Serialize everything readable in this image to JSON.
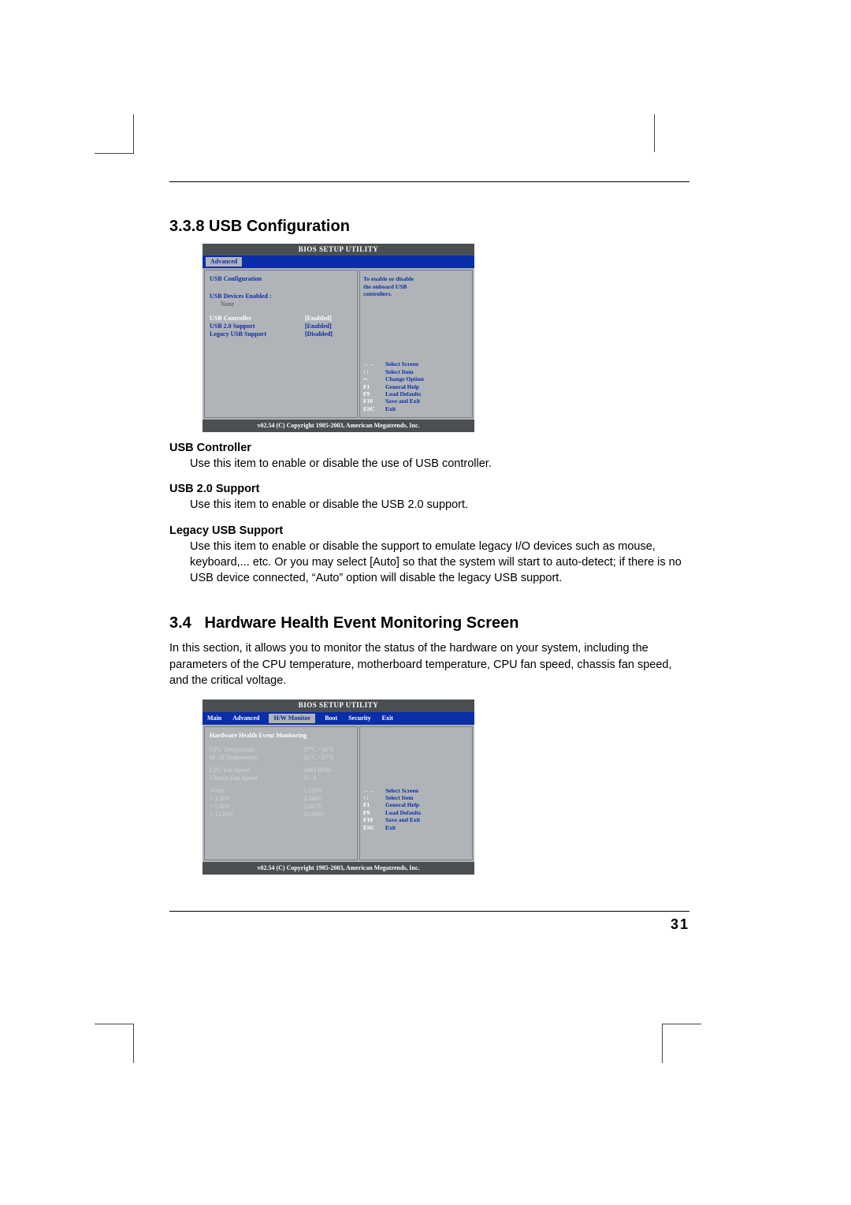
{
  "section1": {
    "number": "3.3.8",
    "title": "USB Configuration"
  },
  "bios1": {
    "title": "BIOS SETUP UTILITY",
    "active_tab": "Advanced",
    "panel_title": "USB Configuration",
    "devices_label": "USB Devices Enabled :",
    "devices_value": "None",
    "rows": [
      {
        "label": "USB Controller",
        "value": "[Enabled]",
        "hl": true
      },
      {
        "label": "USB 2.0 Support",
        "value": "[Enabled]"
      },
      {
        "label": "Legacy USB Support",
        "value": "[Disabled]"
      }
    ],
    "help_top": [
      "To enable or disable",
      "the onboard USB",
      "controllers."
    ],
    "keys": [
      {
        "k": "←→",
        "d": "Select Screen"
      },
      {
        "k": "↑↓",
        "d": "Select Item"
      },
      {
        "k": "+-",
        "d": "Change Option"
      },
      {
        "k": "F1",
        "d": "General Help"
      },
      {
        "k": "F9",
        "d": "Load Defaults"
      },
      {
        "k": "F10",
        "d": "Save and Exit"
      },
      {
        "k": "ESC",
        "d": "Exit"
      }
    ],
    "footer": "v02.54 (C) Copyright 1985-2003, American Megatrends, Inc."
  },
  "terms": {
    "t1": "USB Controller",
    "d1": "Use this item to enable or disable the use of USB controller.",
    "t2": "USB 2.0 Support",
    "d2": "Use this item to enable or disable the USB 2.0 support.",
    "t3": "Legacy USB Support",
    "d3a": "Use this item to enable or disable the support to emulate legacy I/O",
    "d3b": "devices such as mouse, keyboard,... etc. Or you may select [Auto] so",
    "d3c": "that the system will start to auto-detect; if there is no USB  device",
    "d3d": "connected,  “Auto” option will disable the legacy USB support."
  },
  "section2": {
    "number": "3.4",
    "title": "Hardware Health Event Monitoring Screen",
    "intro1": "In this section, it allows you to monitor the status of the hardware on your system,",
    "intro2": "including the parameters of the CPU temperature, motherboard temperature, CPU fan",
    "intro3": "speed, chassis fan speed, and the critical voltage."
  },
  "bios2": {
    "title": "BIOS SETUP UTILITY",
    "tabs": [
      "Main",
      "Advanced",
      "H/W Monitor",
      "Boot",
      "Security",
      "Exit"
    ],
    "active_tab": "H/W Monitor",
    "panel_title": "Hardware Health Event Monitoring",
    "rows": [
      {
        "l": "CPU Temperature",
        "v": ": 37°C / 98°F"
      },
      {
        "l": "M / B Temperature",
        "v": ": 31°C / 87°F"
      },
      {
        "l": "",
        "v": ""
      },
      {
        "l": "CPU Fan Speed",
        "v": ": 2463 RPM"
      },
      {
        "l": "Chassis Fan Speed",
        "v": ": N / A"
      },
      {
        "l": "",
        "v": ""
      },
      {
        "l": "Vcore",
        "v": ": 1.629V"
      },
      {
        "l": "+ 3.30V",
        "v": ": 3.306V"
      },
      {
        "l": "+ 5.00V",
        "v": ": 5.067V"
      },
      {
        "l": "+ 12.00V",
        "v": ": 11.890V"
      }
    ],
    "keys": [
      {
        "k": "←→",
        "d": "Select Screen"
      },
      {
        "k": "↑↓",
        "d": "Select Item"
      },
      {
        "k": "F1",
        "d": "General Help"
      },
      {
        "k": "F9",
        "d": "Load Defaults"
      },
      {
        "k": "F10",
        "d": "Save and Exit"
      },
      {
        "k": "ESC",
        "d": "Exit"
      }
    ],
    "footer": "v02.54 (C) Copyright 1985-2003, American Megatrends, Inc."
  },
  "page_number": "31"
}
